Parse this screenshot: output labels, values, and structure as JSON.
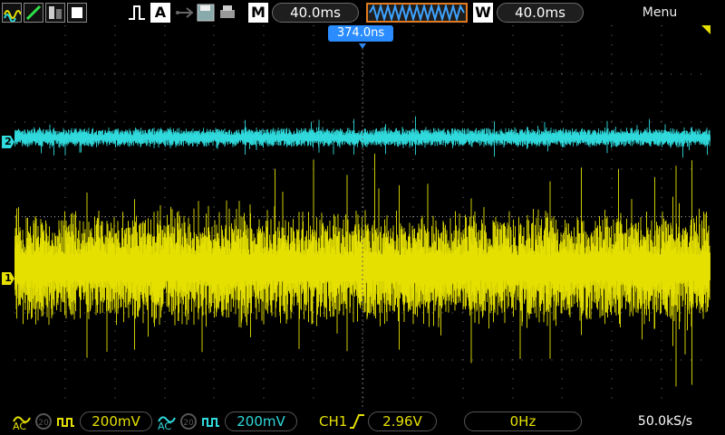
{
  "top": {
    "timebase": "40.0ms",
    "window": "40.0ms",
    "menu": "Menu",
    "acquire_badge": "A",
    "mode_badge": "M",
    "window_badge": "W",
    "trigger_position": "374.0ns"
  },
  "channels": {
    "ch1": {
      "label": "1",
      "color": "#e5e000",
      "scale": "200mV",
      "coupling": "AC"
    },
    "ch2": {
      "label": "2",
      "color": "#2fd9dc",
      "scale": "200mV",
      "coupling": "AC"
    }
  },
  "trigger": {
    "source": "CH1",
    "level": "2.96V",
    "frequency": "0Hz"
  },
  "sample_rate": "50.0kS/s",
  "icons": [
    "waveform-icon",
    "ramp-icon",
    "cursor-icon",
    "run-stop-icon",
    "usb-icon",
    "save-icon",
    "print-icon",
    "trigger-edge-icon"
  ]
}
